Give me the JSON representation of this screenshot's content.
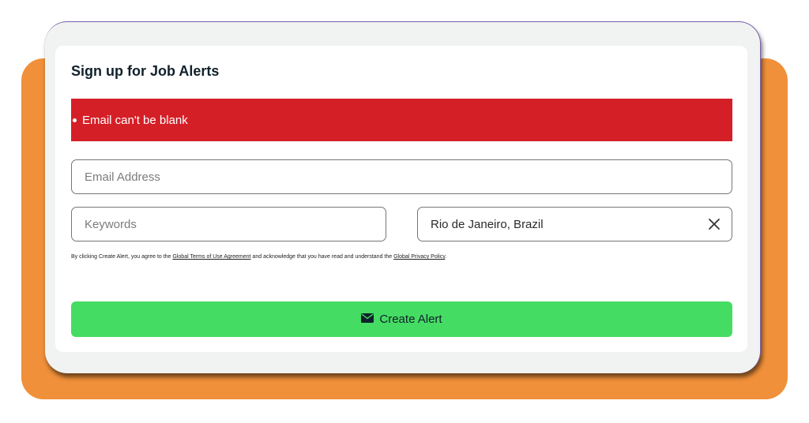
{
  "form": {
    "title": "Sign up for Job Alerts",
    "error_message": "Email can't be blank",
    "email_placeholder": "Email Address",
    "keywords_placeholder": "Keywords",
    "location_value": "Rio de Janeiro, Brazil",
    "legal": {
      "text_1": "By clicking Create Alert, you agree to the ",
      "terms_link": "Global Terms of Use Agreement",
      "text_2": " and acknowledge that you have read and understand the ",
      "privacy_link": "Global Privacy Policy",
      "text_3": "."
    },
    "submit_label": "Create Alert",
    "submit_icon": "envelope-icon",
    "clear_icon": "close-icon"
  },
  "colors": {
    "error_bg": "#d51f27",
    "button_bg": "#45dc64",
    "backdrop_orange": "#f0903a"
  }
}
